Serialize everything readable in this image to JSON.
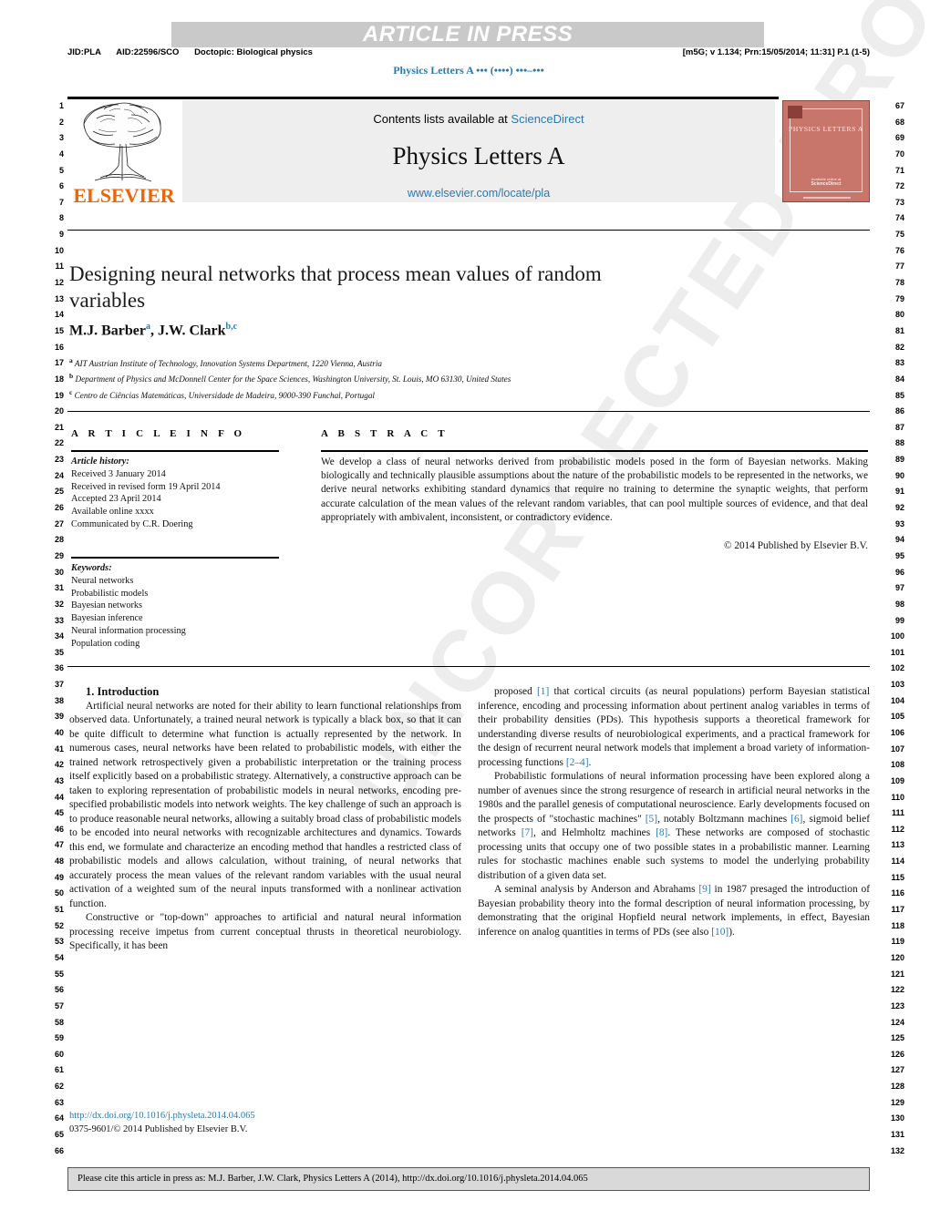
{
  "header": {
    "banner_text": "ARTICLE IN PRESS",
    "jid": "JID:PLA",
    "aid": "AID:22596/SCO",
    "doctopic": "Doctopic: Biological physics",
    "prn_stamp": "[m5G; v 1.134; Prn:15/05/2014; 11:31] P.1 (1-5)",
    "running_head": "Physics Letters A ••• (••••) •••–•••"
  },
  "masthead": {
    "contents_prefix": "Contents lists available at ",
    "sciencedirect": "ScienceDirect",
    "journal_title": "Physics Letters A",
    "journal_url": "www.elsevier.com/locate/pla",
    "publisher_logo_text": "ELSEVIER",
    "cover_title": "PHYSICS LETTERS A",
    "cover_foot_small": "Available online at",
    "cover_foot_bold": "ScienceDirect"
  },
  "article": {
    "title": "Designing neural networks that process mean values of random variables",
    "authors_html": "M.J. Barber<sup>a</sup>, J.W. Clark<sup>b,c</sup>",
    "affiliations": [
      {
        "marker": "a",
        "text": "AIT Austrian Institute of Technology, Innovation Systems Department, 1220 Vienna, Austria"
      },
      {
        "marker": "b",
        "text": "Department of Physics and McDonnell Center for the Space Sciences, Washington University, St. Louis, MO 63130, United States"
      },
      {
        "marker": "c",
        "text": "Centro de Ciências Matemáticas, Universidade de Madeira, 9000-390 Funchal, Portugal"
      }
    ]
  },
  "info": {
    "heading": "A R T I C L E   I N F O",
    "history_label": "Article history:",
    "history": [
      "Received 3 January 2014",
      "Received in revised form 19 April 2014",
      "Accepted 23 April 2014",
      "Available online xxxx",
      "Communicated by C.R. Doering"
    ],
    "keywords_label": "Keywords:",
    "keywords": [
      "Neural networks",
      "Probabilistic models",
      "Bayesian networks",
      "Bayesian inference",
      "Neural information processing",
      "Population coding"
    ]
  },
  "abstract": {
    "heading": "A B S T R A C T",
    "text": "We develop a class of neural networks derived from probabilistic models posed in the form of Bayesian networks. Making biologically and technically plausible assumptions about the nature of the probabilistic models to be represented in the networks, we derive neural networks exhibiting standard dynamics that require no training to determine the synaptic weights, that perform accurate calculation of the mean values of the relevant random variables, that can pool multiple sources of evidence, and that deal appropriately with ambivalent, inconsistent, or contradictory evidence.",
    "copyright": "© 2014 Published by Elsevier B.V."
  },
  "body": {
    "section_title": "1. Introduction",
    "left_paragraphs": [
      "Artificial neural networks are noted for their ability to learn functional relationships from observed data. Unfortunately, a trained neural network is typically a black box, so that it can be quite difficult to determine what function is actually represented by the network. In numerous cases, neural networks have been related to probabilistic models, with either the trained network retrospectively given a probabilistic interpretation or the training process itself explicitly based on a probabilistic strategy. Alternatively, a constructive approach can be taken to exploring representation of probabilistic models in neural networks, encoding pre-specified probabilistic models into network weights. The key challenge of such an approach is to produce reasonable neural networks, allowing a suitably broad class of probabilistic models to be encoded into neural networks with recognizable architectures and dynamics. Towards this end, we formulate and characterize an encoding method that handles a restricted class of probabilistic models and allows calculation, without training, of neural networks that accurately process the mean values of the relevant random variables with the usual neural activation of a weighted sum of the neural inputs transformed with a nonlinear activation function.",
      "Constructive or \"top-down\" approaches to artificial and natural neural information processing receive impetus from current conceptual thrusts in theoretical neurobiology. Specifically, it has been"
    ],
    "right_paragraphs_html": [
      "proposed <span class=\"ref\">[1]</span> that cortical circuits (as neural populations) perform Bayesian statistical inference, encoding and processing information about pertinent analog variables in terms of their probability densities (PDs). This hypothesis supports a theoretical framework for understanding diverse results of neurobiological experiments, and a practical framework for the design of recurrent neural network models that implement a broad variety of information-processing functions <span class=\"ref\">[2–4]</span>.",
      "Probabilistic formulations of neural information processing have been explored along a number of avenues since the strong resurgence of research in artificial neural networks in the 1980s and the parallel genesis of computational neuroscience. Early developments focused on the prospects of \"stochastic machines\" <span class=\"ref\">[5]</span>, notably Boltzmann machines <span class=\"ref\">[6]</span>, sigmoid belief networks <span class=\"ref\">[7]</span>, and Helmholtz machines <span class=\"ref\">[8]</span>. These networks are composed of stochastic processing units that occupy one of two possible states in a probabilistic manner. Learning rules for stochastic machines enable such systems to model the underlying probability distribution of a given data set.",
      "A seminal analysis by Anderson and Abrahams <span class=\"ref\">[9]</span> in 1987 presaged the introduction of Bayesian probability theory into the formal description of neural information processing, by demonstrating that the original Hopfield neural network implements, in effect, Bayesian inference on analog quantities in terms of PDs (see also <span class=\"ref\">[10]</span>)."
    ]
  },
  "footer": {
    "doi": "http://dx.doi.org/10.1016/j.physleta.2014.04.065",
    "issn": "0375-9601/© 2014 Published by Elsevier B.V.",
    "cite_notice": "Please cite this article in press as: M.J. Barber, J.W. Clark, Physics Letters A (2014), http://dx.doi.org/10.1016/j.physleta.2014.04.065"
  },
  "line_numbers": {
    "left_start": 1,
    "left_end": 66,
    "right_start": 67,
    "right_end": 132
  },
  "watermark": {
    "text": "UNCORRECTED PROOF"
  },
  "colors": {
    "link": "#2a7ab0",
    "elsevier_orange": "#eb6608",
    "banner_gray": "#c9c9c9",
    "masthead_gray": "#eeeeee",
    "cover_red": "#c8766c"
  }
}
